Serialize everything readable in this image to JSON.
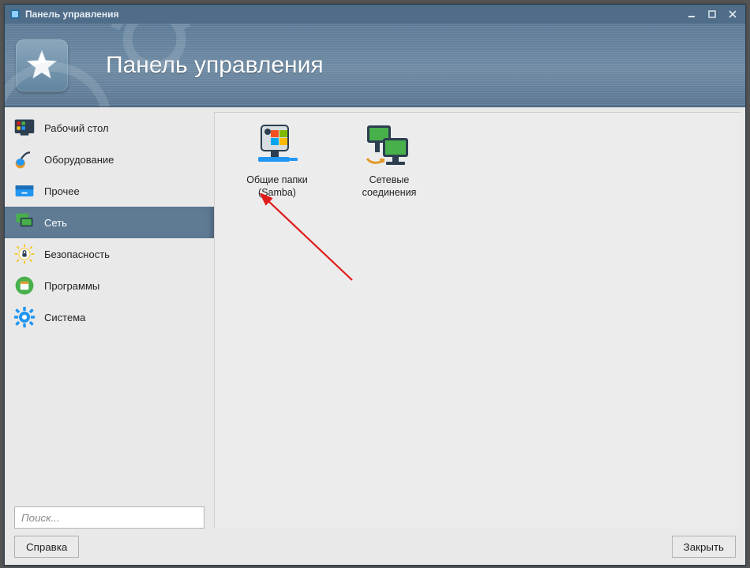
{
  "window": {
    "title": "Панель управления"
  },
  "banner": {
    "title": "Панель управления"
  },
  "sidebar": {
    "items": [
      {
        "label": "Рабочий стол"
      },
      {
        "label": "Оборудование"
      },
      {
        "label": "Прочее"
      },
      {
        "label": "Сеть"
      },
      {
        "label": "Безопасность"
      },
      {
        "label": "Программы"
      },
      {
        "label": "Система"
      }
    ],
    "active_index": 3
  },
  "search": {
    "placeholder": "Поиск..."
  },
  "main": {
    "items": [
      {
        "line1": "Общие папки",
        "line2": "(Samba)"
      },
      {
        "line1": "Сетевые",
        "line2": "соединения"
      }
    ]
  },
  "footer": {
    "help": "Справка",
    "close": "Закрыть"
  },
  "colors": {
    "accent": "#5f7b94",
    "titlebar": "#4f6d89",
    "icon_green": "#47b04b",
    "icon_dark": "#2c3e50",
    "icon_orange": "#e29a2a",
    "icon_blue": "#2196f3",
    "icon_yellow": "#f5c518",
    "arrow": "#e11b1b"
  }
}
